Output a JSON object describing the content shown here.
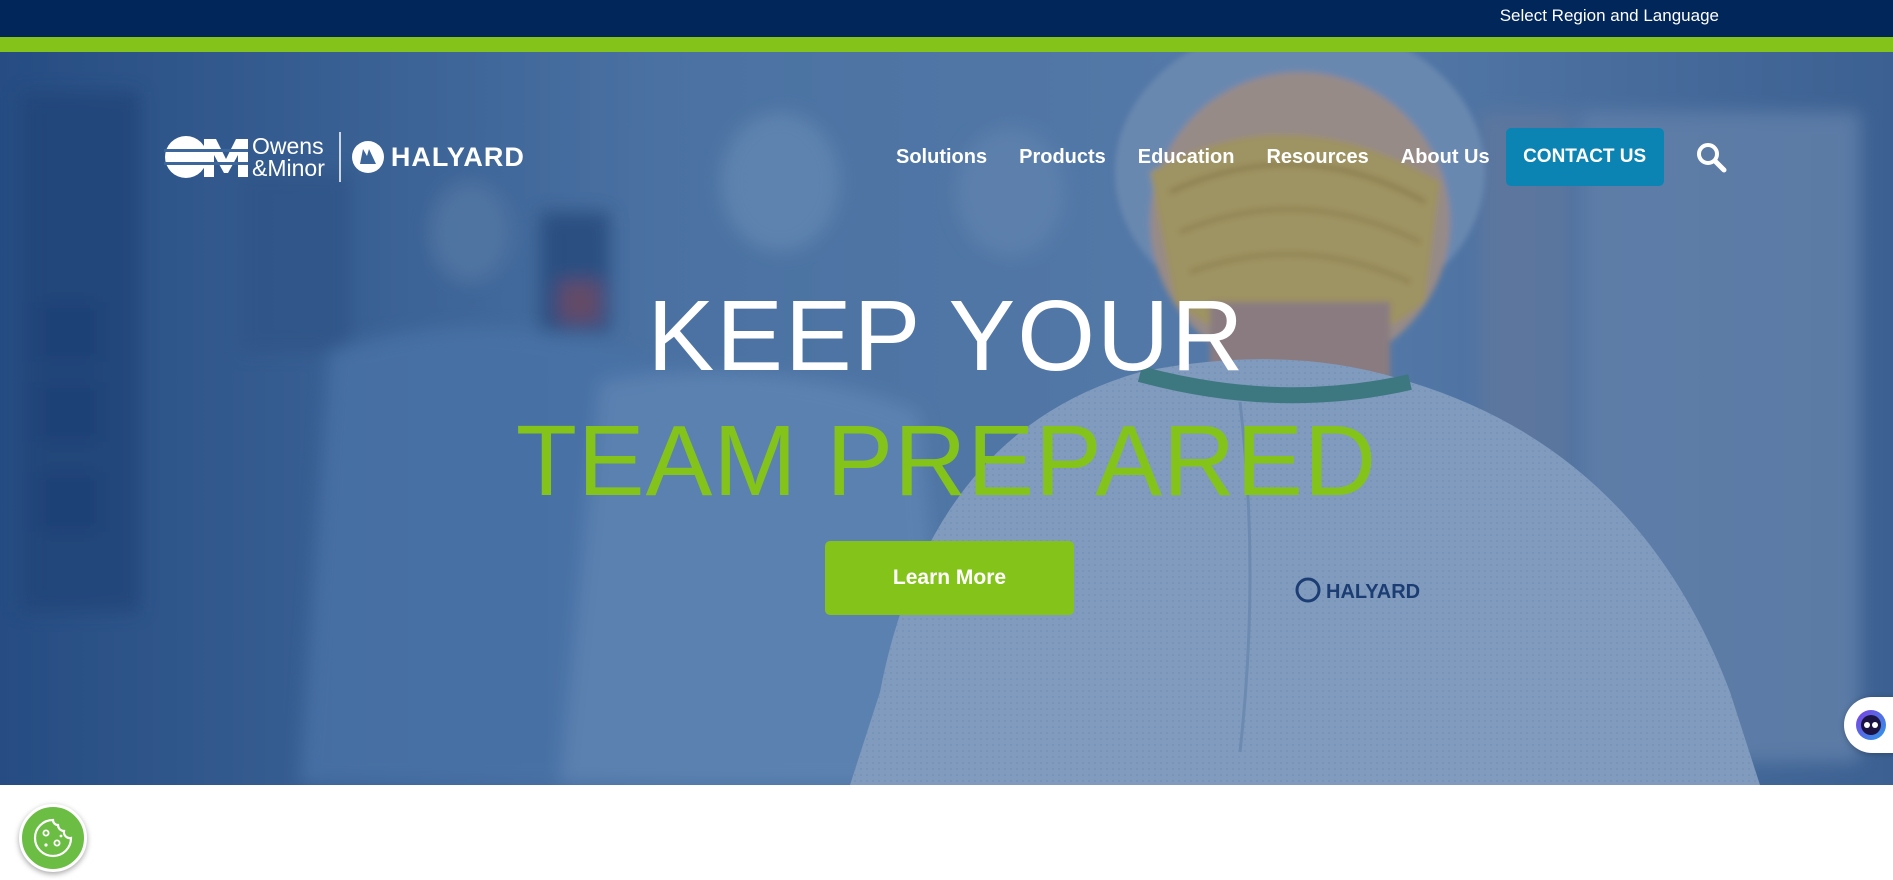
{
  "topbar": {
    "region_link": "Select Region and Language"
  },
  "logo": {
    "om_line1": "Owens",
    "om_line2": "&Minor",
    "halyard": "HALYARD"
  },
  "nav": {
    "items": [
      {
        "label": "Solutions"
      },
      {
        "label": "Products"
      },
      {
        "label": "Education"
      },
      {
        "label": "Resources"
      },
      {
        "label": "About Us"
      }
    ],
    "contact_label": "CONTACT US",
    "search_icon": "search-icon"
  },
  "hero": {
    "headline_line1": "KEEP YOUR",
    "headline_line2": "TEAM PREPARED",
    "cta_label": "Learn More",
    "gown_brand": "HALYARD"
  },
  "widgets": {
    "chat_icon": "chat-assistant-icon",
    "cookie_icon": "cookie-icon"
  },
  "colors": {
    "topbar": "#00265a",
    "accent_green": "#84c41a",
    "contact_blue": "#0b84b3",
    "cookie_green": "#6cbd44"
  }
}
